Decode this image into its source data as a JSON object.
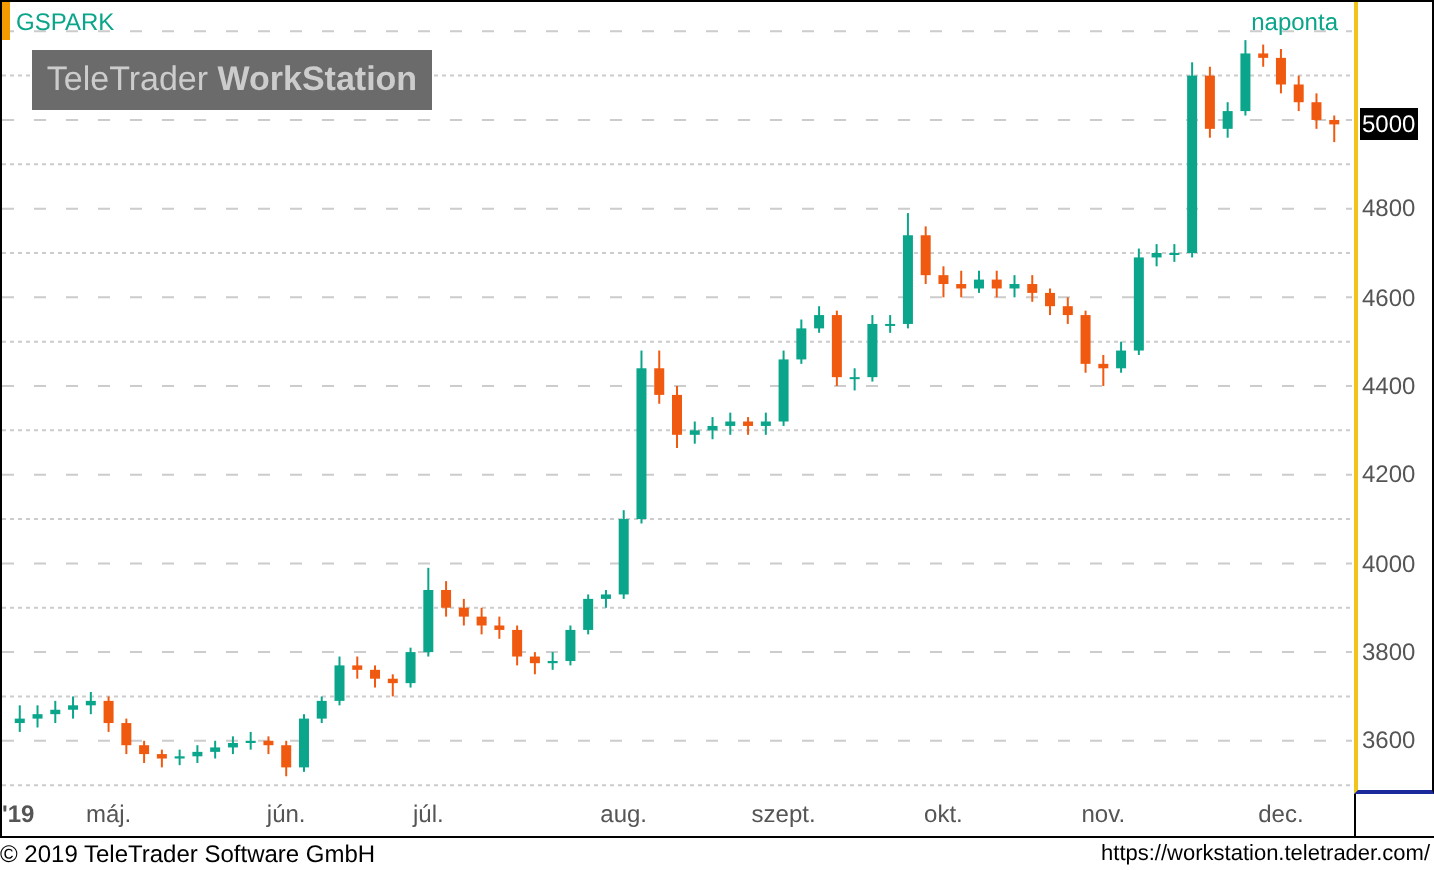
{
  "chart": {
    "symbol": "GSPARK",
    "period": "naponta",
    "year": "'19",
    "logo": "TeleTrader **WorkStation**",
    "last_price": "5000",
    "chart_data": {
      "type": "candlestick",
      "grid": true,
      "ylim": [
        3480,
        5266
      ],
      "yticks": [
        {
          "value": 4800,
          "label": "4800"
        },
        {
          "value": 4600,
          "label": "4600"
        },
        {
          "value": 4400,
          "label": "4400"
        },
        {
          "value": 4200,
          "label": "4200"
        },
        {
          "value": 4000,
          "label": "4000"
        },
        {
          "value": 3800,
          "label": "3800"
        },
        {
          "value": 3600,
          "label": "3600"
        }
      ],
      "categories": [
        null,
        null,
        null,
        null,
        null,
        "máj.",
        null,
        null,
        null,
        null,
        null,
        null,
        null,
        null,
        null,
        "jún.",
        null,
        null,
        null,
        null,
        null,
        null,
        null,
        "júl.",
        null,
        null,
        null,
        null,
        null,
        null,
        null,
        null,
        null,
        null,
        "aug.",
        null,
        null,
        null,
        null,
        null,
        null,
        null,
        null,
        "szept.",
        null,
        null,
        null,
        null,
        null,
        null,
        null,
        null,
        "okt.",
        null,
        null,
        null,
        null,
        null,
        null,
        null,
        null,
        "nov.",
        null,
        null,
        null,
        null,
        null,
        null,
        null,
        null,
        null,
        "dec.",
        null,
        null,
        null
      ],
      "ohlc": [
        [
          3640,
          3680,
          3620,
          3650
        ],
        [
          3650,
          3680,
          3630,
          3660
        ],
        [
          3660,
          3690,
          3640,
          3670
        ],
        [
          3670,
          3700,
          3650,
          3680
        ],
        [
          3680,
          3710,
          3660,
          3690
        ],
        [
          3690,
          3700,
          3620,
          3640
        ],
        [
          3640,
          3650,
          3570,
          3590
        ],
        [
          3590,
          3600,
          3550,
          3570
        ],
        [
          3570,
          3580,
          3540,
          3560
        ],
        [
          3560,
          3580,
          3545,
          3565
        ],
        [
          3565,
          3590,
          3550,
          3575
        ],
        [
          3575,
          3600,
          3560,
          3585
        ],
        [
          3585,
          3610,
          3570,
          3595
        ],
        [
          3595,
          3620,
          3580,
          3600
        ],
        [
          3600,
          3610,
          3570,
          3590
        ],
        [
          3590,
          3600,
          3520,
          3540
        ],
        [
          3540,
          3660,
          3530,
          3650
        ],
        [
          3650,
          3700,
          3640,
          3690
        ],
        [
          3690,
          3790,
          3680,
          3770
        ],
        [
          3770,
          3790,
          3740,
          3760
        ],
        [
          3760,
          3770,
          3720,
          3740
        ],
        [
          3740,
          3750,
          3700,
          3730
        ],
        [
          3730,
          3810,
          3720,
          3800
        ],
        [
          3800,
          3990,
          3790,
          3940
        ],
        [
          3940,
          3960,
          3880,
          3900
        ],
        [
          3900,
          3920,
          3860,
          3880
        ],
        [
          3880,
          3900,
          3840,
          3860
        ],
        [
          3860,
          3880,
          3830,
          3850
        ],
        [
          3850,
          3860,
          3770,
          3790
        ],
        [
          3790,
          3800,
          3750,
          3775
        ],
        [
          3775,
          3800,
          3760,
          3780
        ],
        [
          3780,
          3860,
          3770,
          3850
        ],
        [
          3850,
          3930,
          3840,
          3920
        ],
        [
          3920,
          3940,
          3900,
          3930
        ],
        [
          3930,
          4120,
          3920,
          4100
        ],
        [
          4100,
          4480,
          4090,
          4440
        ],
        [
          4440,
          4480,
          4360,
          4380
        ],
        [
          4380,
          4400,
          4260,
          4290
        ],
        [
          4290,
          4320,
          4270,
          4300
        ],
        [
          4300,
          4330,
          4280,
          4310
        ],
        [
          4310,
          4340,
          4290,
          4320
        ],
        [
          4320,
          4330,
          4290,
          4310
        ],
        [
          4310,
          4340,
          4290,
          4320
        ],
        [
          4320,
          4480,
          4310,
          4460
        ],
        [
          4460,
          4550,
          4450,
          4530
        ],
        [
          4530,
          4580,
          4520,
          4560
        ],
        [
          4560,
          4570,
          4400,
          4420
        ],
        [
          4420,
          4440,
          4390,
          4420
        ],
        [
          4420,
          4560,
          4410,
          4540
        ],
        [
          4540,
          4560,
          4520,
          4540
        ],
        [
          4540,
          4790,
          4530,
          4740
        ],
        [
          4740,
          4760,
          4630,
          4650
        ],
        [
          4650,
          4670,
          4600,
          4630
        ],
        [
          4630,
          4660,
          4600,
          4620
        ],
        [
          4620,
          4660,
          4610,
          4640
        ],
        [
          4640,
          4660,
          4600,
          4620
        ],
        [
          4620,
          4650,
          4600,
          4630
        ],
        [
          4630,
          4650,
          4590,
          4610
        ],
        [
          4610,
          4620,
          4560,
          4580
        ],
        [
          4580,
          4600,
          4540,
          4560
        ],
        [
          4560,
          4570,
          4430,
          4450
        ],
        [
          4450,
          4470,
          4400,
          4440
        ],
        [
          4440,
          4500,
          4430,
          4480
        ],
        [
          4480,
          4710,
          4470,
          4690
        ],
        [
          4690,
          4720,
          4670,
          4700
        ],
        [
          4700,
          4720,
          4680,
          4700
        ],
        [
          4700,
          5130,
          4690,
          5100
        ],
        [
          5100,
          5120,
          4960,
          4980
        ],
        [
          4980,
          5040,
          4960,
          5020
        ],
        [
          5020,
          5180,
          5010,
          5150
        ],
        [
          5150,
          5170,
          5120,
          5140
        ],
        [
          5140,
          5160,
          5060,
          5080
        ],
        [
          5080,
          5100,
          5020,
          5040
        ],
        [
          5040,
          5060,
          4980,
          5000
        ],
        [
          5000,
          5010,
          4950,
          4990
        ]
      ]
    }
  },
  "footer": {
    "copyright": "© 2019 TeleTrader Software GmbH",
    "url": "https://workstation.teletrader.com/"
  }
}
